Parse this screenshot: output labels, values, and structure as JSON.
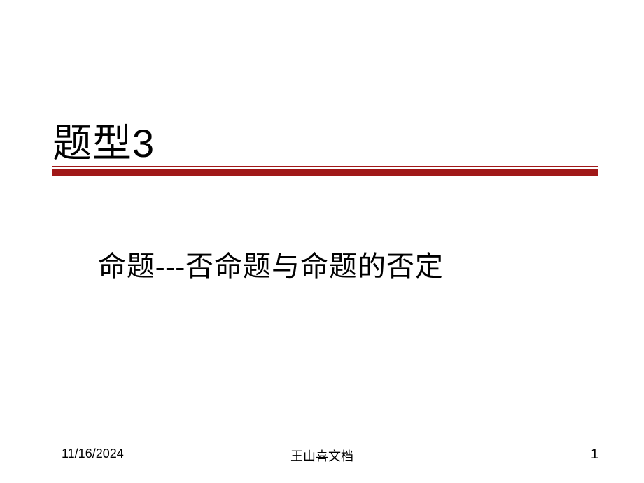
{
  "slide": {
    "title_prefix": "题型",
    "title_number": "3",
    "subtitle": "命题---否命题与命题的否定",
    "footer": {
      "date": "11/16/2024",
      "author": "王山喜文档",
      "page_number": "1"
    },
    "colors": {
      "accent": "#a01818",
      "text": "#000000",
      "background": "#ffffff"
    }
  }
}
